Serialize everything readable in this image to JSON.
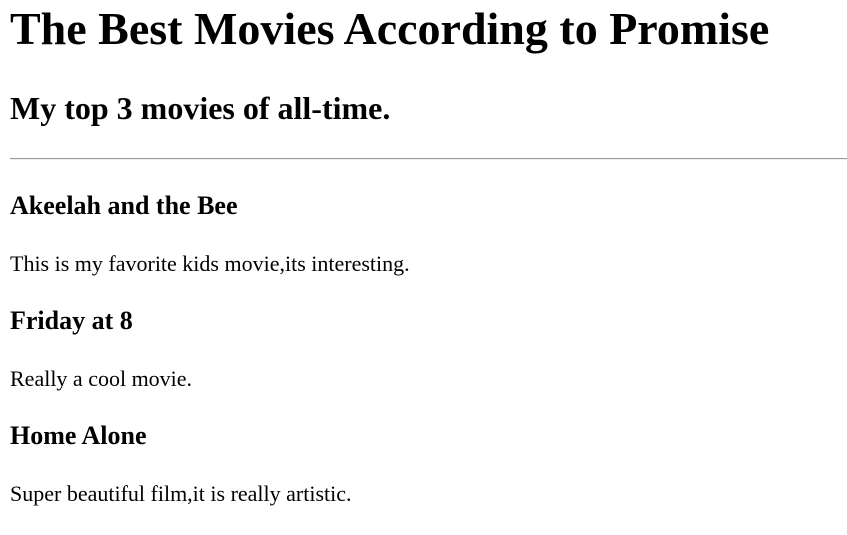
{
  "page": {
    "heading": "The Best Movies According to Promise",
    "subheading": "My top 3 movies of all-time."
  },
  "movies": [
    {
      "title": "Akeelah and the Bee",
      "description": "This is my favorite kids movie,its interesting."
    },
    {
      "title": "Friday at 8",
      "description": "Really a cool movie."
    },
    {
      "title": "Home Alone",
      "description": "Super beautiful film,it is really artistic."
    }
  ]
}
